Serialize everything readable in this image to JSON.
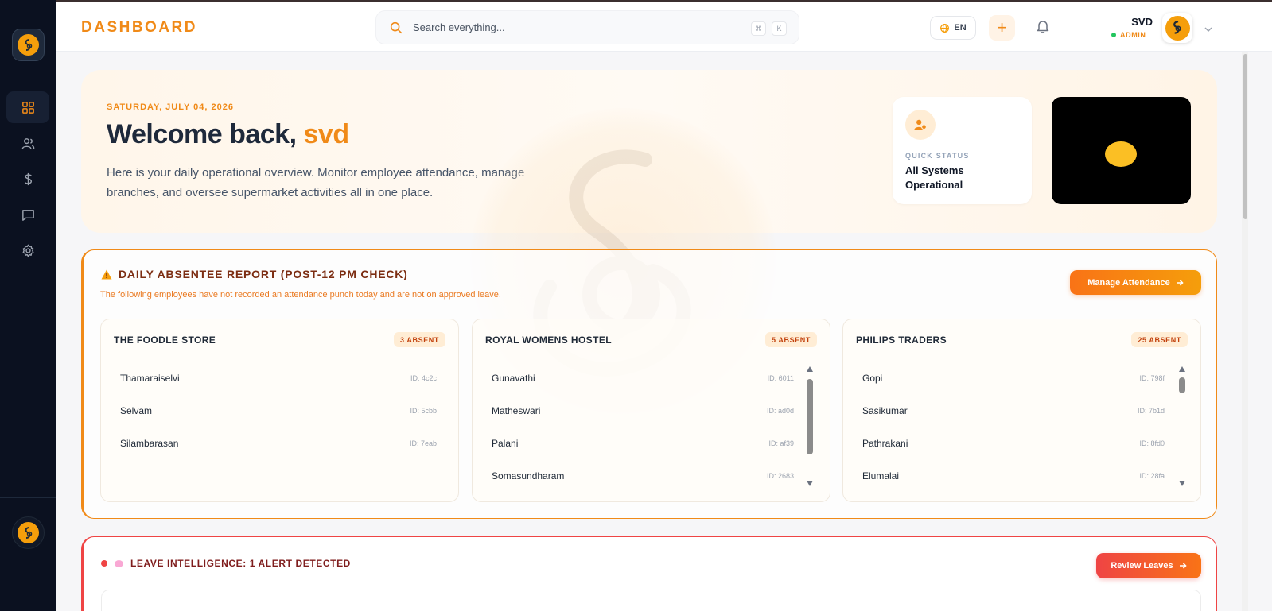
{
  "app": {
    "brand": "DASHBOARD"
  },
  "sidebar": {
    "items": [
      {
        "icon": "grid-icon",
        "active": true
      },
      {
        "icon": "users-icon",
        "active": false
      },
      {
        "icon": "dollar-icon",
        "active": false
      },
      {
        "icon": "message-icon",
        "active": false
      },
      {
        "icon": "gear-icon",
        "active": false
      }
    ]
  },
  "header": {
    "search_placeholder": "Search everything...",
    "shortcut_keys": [
      "⌘",
      "K"
    ],
    "language": "EN",
    "add_label": "+",
    "user_name": "SVD",
    "user_role": "ADMIN"
  },
  "hero": {
    "date": "SATURDAY, JULY 04, 2026",
    "greeting": "Welcome back,",
    "user": "svd",
    "description": "Here is your daily operational overview. Monitor employee attendance, manage branches, and oversee supermarket activities all in one place.",
    "quick_status_label": "QUICK STATUS",
    "quick_status_value": "All Systems Operational"
  },
  "absentee": {
    "title": "DAILY ABSENTEE REPORT (POST-12 PM CHECK)",
    "subtitle": "The following employees have not recorded an attendance punch today and are not on approved leave.",
    "button": "Manage Attendance",
    "branches": [
      {
        "name": "THE FOODLE STORE",
        "badge": "3 ABSENT",
        "employees": [
          {
            "name": "Thamaraiselvi",
            "id": "ID: 4c2c"
          },
          {
            "name": "Selvam",
            "id": "ID: 5cbb"
          },
          {
            "name": "Silambarasan",
            "id": "ID: 7eab"
          }
        ]
      },
      {
        "name": "ROYAL WOMENS HOSTEL",
        "badge": "5 ABSENT",
        "employees": [
          {
            "name": "Gunavathi",
            "id": "ID: 6011"
          },
          {
            "name": "Matheswari",
            "id": "ID: ad0d"
          },
          {
            "name": "Palani",
            "id": "ID: af39"
          },
          {
            "name": "Somasundharam",
            "id": "ID: 2683"
          }
        ]
      },
      {
        "name": "PHILIPS TRADERS",
        "badge": "25 ABSENT",
        "employees": [
          {
            "name": "Gopi",
            "id": "ID: 798f"
          },
          {
            "name": "Sasikumar",
            "id": "ID: 7b1d"
          },
          {
            "name": "Pathrakani",
            "id": "ID: 8fd0"
          },
          {
            "name": "Elumalai",
            "id": "ID: 28fa"
          }
        ]
      }
    ]
  },
  "leave": {
    "title": "LEAVE INTELLIGENCE: 1 ALERT DETECTED",
    "button": "Review Leaves"
  },
  "colors": {
    "accent": "#f08a18",
    "sidebar": "#0b1120",
    "alert_red": "#ef4444"
  }
}
